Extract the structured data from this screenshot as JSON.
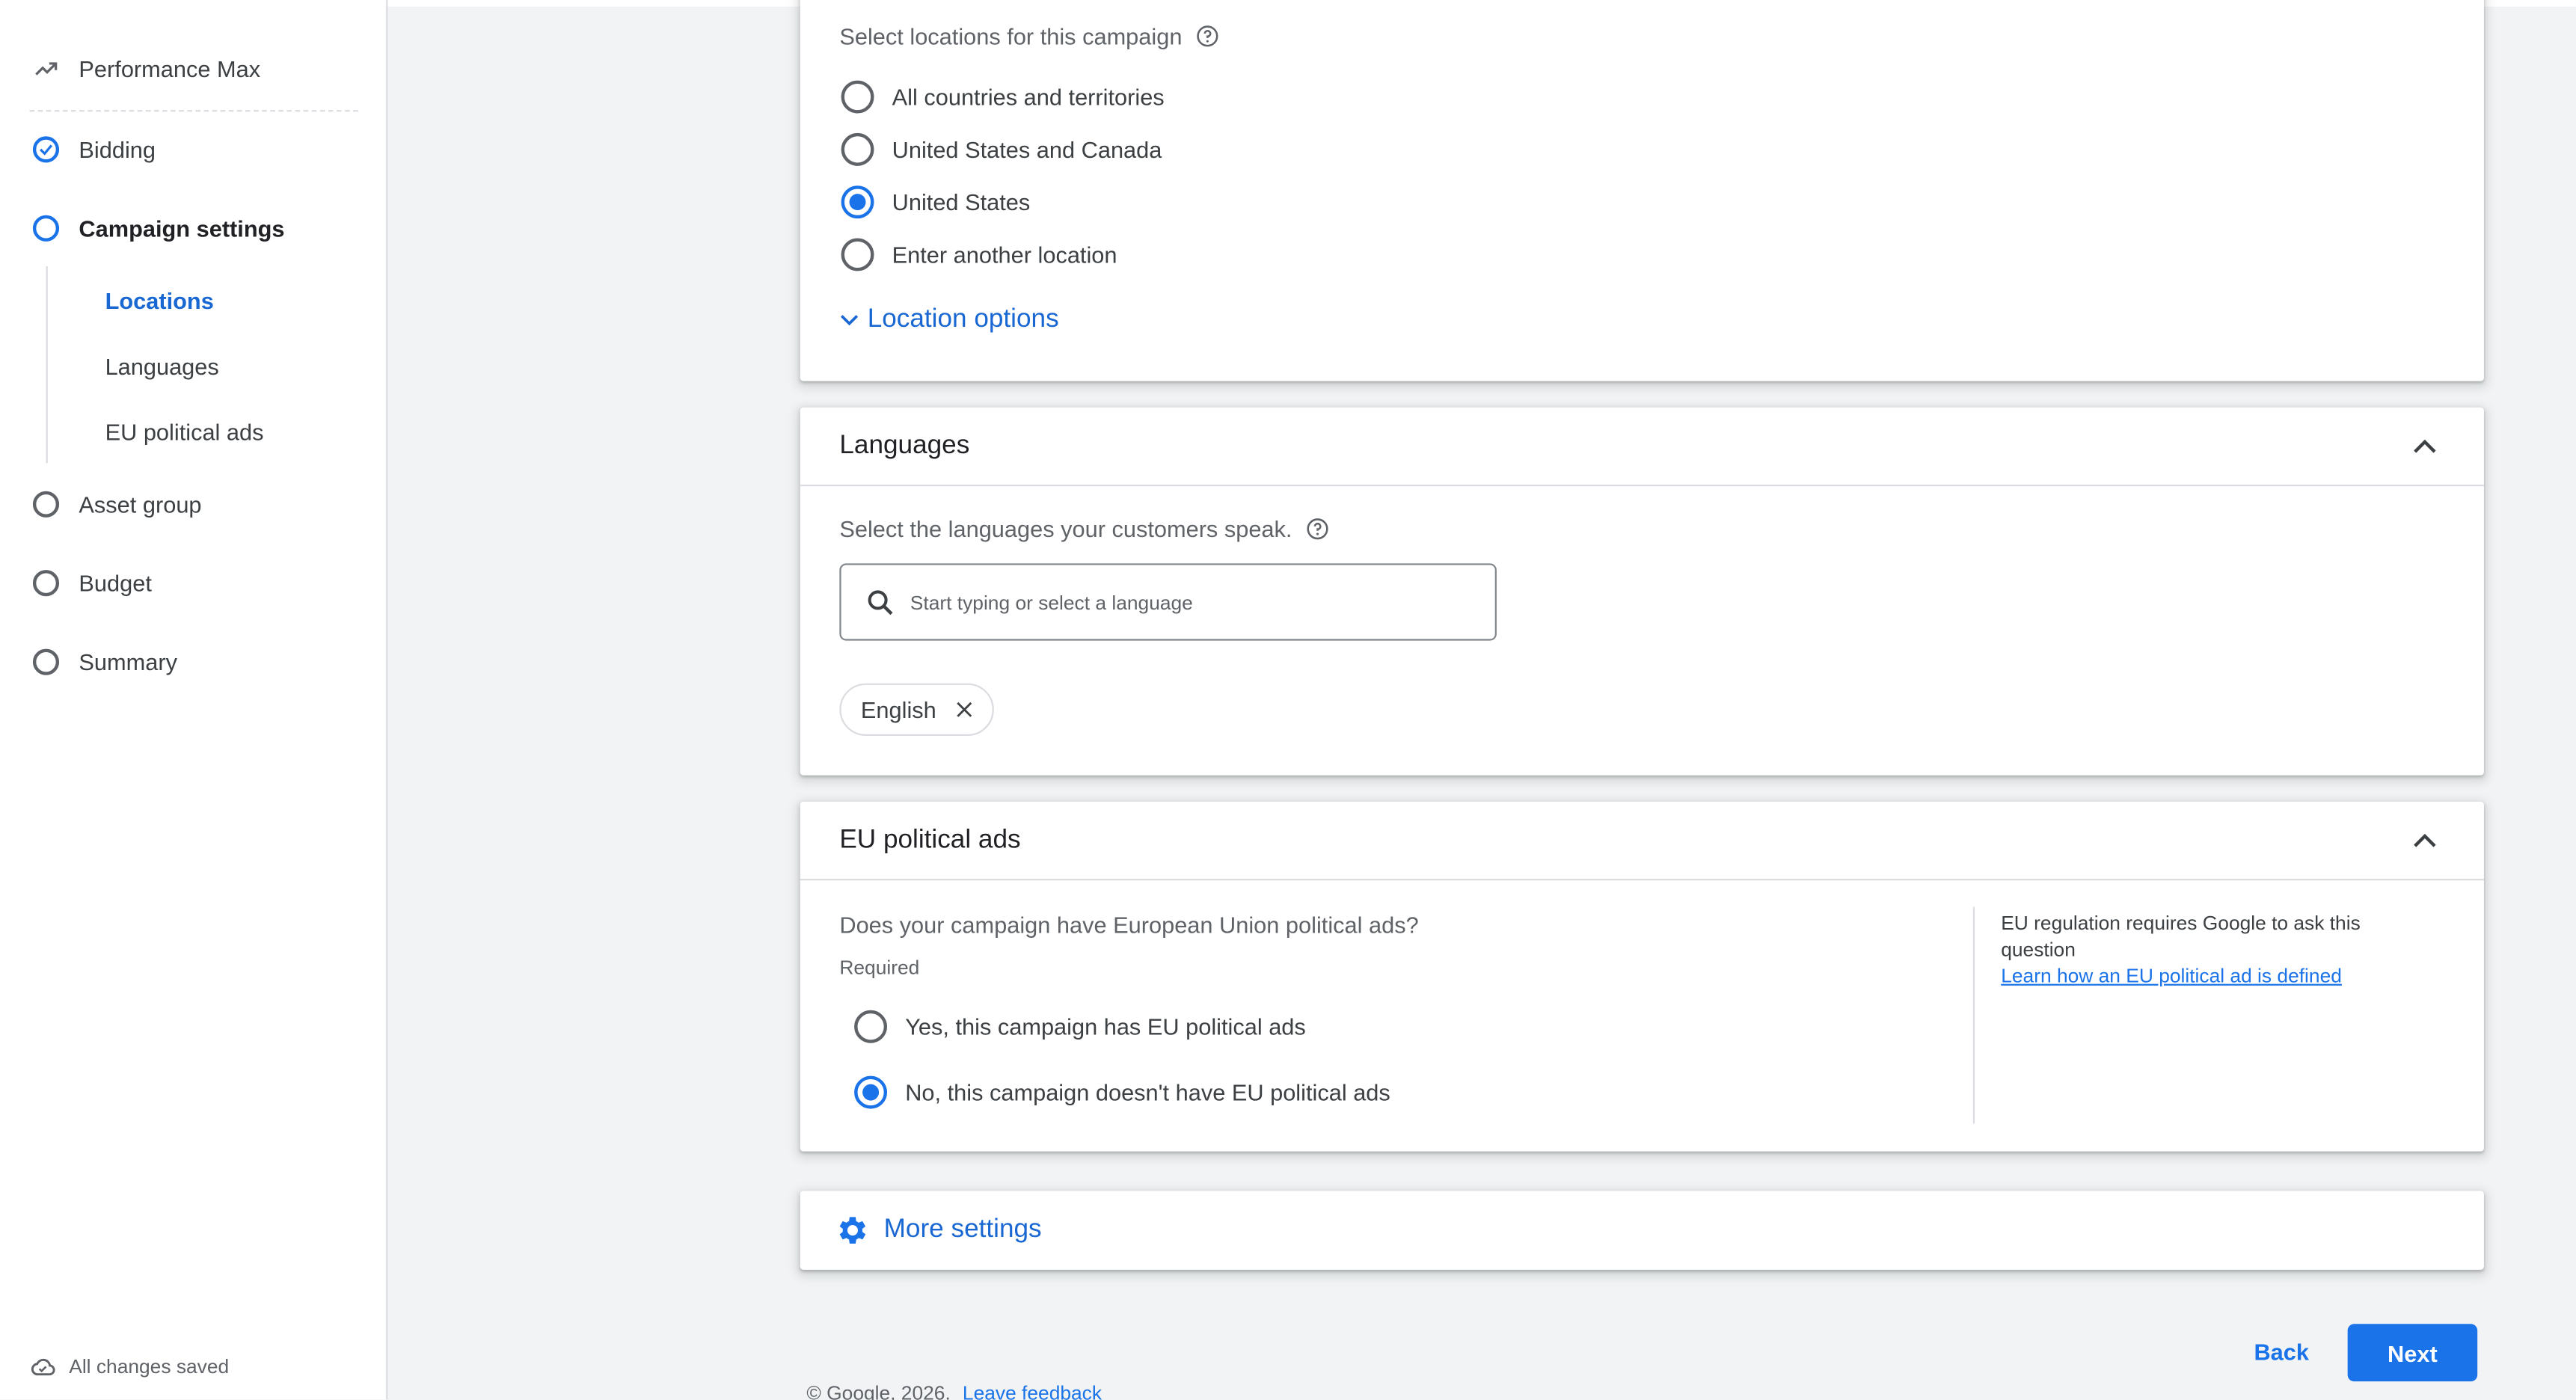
{
  "sidebar": {
    "title": "Performance Max",
    "steps": [
      {
        "label": "Bidding",
        "state": "done"
      },
      {
        "label": "Campaign settings",
        "state": "current"
      },
      {
        "label": "Asset group",
        "state": "todo"
      },
      {
        "label": "Budget",
        "state": "todo"
      },
      {
        "label": "Summary",
        "state": "todo"
      }
    ],
    "substeps": [
      {
        "label": "Locations",
        "active": true
      },
      {
        "label": "Languages",
        "active": false
      },
      {
        "label": "EU political ads",
        "active": false
      }
    ],
    "saved_status": "All changes saved"
  },
  "locations": {
    "prompt": "Select locations for this campaign",
    "options": [
      {
        "label": "All countries and territories",
        "selected": false
      },
      {
        "label": "United States and Canada",
        "selected": false
      },
      {
        "label": "United States",
        "selected": true
      },
      {
        "label": "Enter another location",
        "selected": false
      }
    ],
    "location_options_label": "Location options"
  },
  "languages": {
    "title": "Languages",
    "prompt": "Select the languages your customers speak.",
    "search_placeholder": "Start typing or select a language",
    "selected": [
      "English"
    ]
  },
  "eu_political": {
    "title": "EU political ads",
    "question": "Does your campaign have European Union political ads?",
    "required_label": "Required",
    "options": [
      {
        "label": "Yes, this campaign has EU political ads",
        "selected": false
      },
      {
        "label": "No, this campaign doesn't have EU political ads",
        "selected": true
      }
    ],
    "note": "EU regulation requires Google to ask this question",
    "note_link": "Learn how an EU political ad is defined"
  },
  "more_settings": {
    "label": "More settings"
  },
  "nav": {
    "back": "Back",
    "next": "Next"
  },
  "footer": {
    "copyright": "© Google, 2026.",
    "feedback": "Leave feedback"
  },
  "colors": {
    "accent": "#1a73e8",
    "accent_text": "#1967d2",
    "background": "#f1f3f4"
  }
}
